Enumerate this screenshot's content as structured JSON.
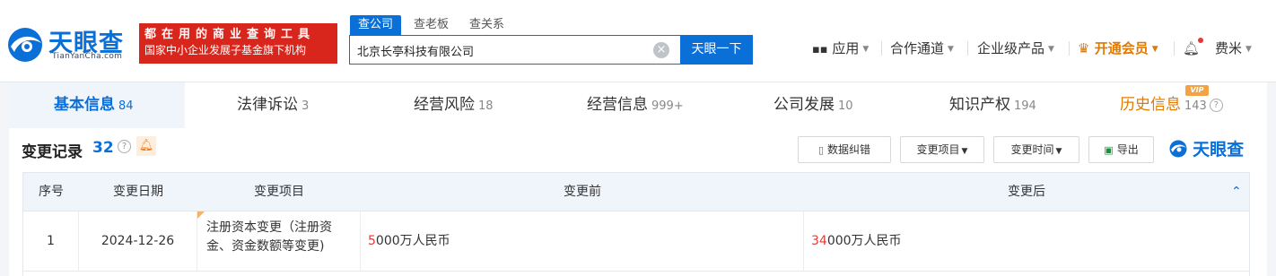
{
  "brand": {
    "name": "天眼查",
    "domain": "TianYanCha.com",
    "color": "#0b6fd8"
  },
  "slogan": {
    "line1": "都在用的商业查询工具",
    "line2": "国家中小企业发展子基金旗下机构"
  },
  "search_tabs": [
    "查公司",
    "查老板",
    "查关系"
  ],
  "search": {
    "value": "北京长亭科技有限公司",
    "button": "天眼一下"
  },
  "nav": {
    "apps": "应用",
    "channel": "合作通道",
    "enterprise": "企业级产品",
    "vip": "开通会员",
    "user": "费米"
  },
  "tabs": [
    {
      "label": "基本信息",
      "count": "84"
    },
    {
      "label": "法律诉讼",
      "count": "3"
    },
    {
      "label": "经营风险",
      "count": "18"
    },
    {
      "label": "经营信息",
      "count": "999+"
    },
    {
      "label": "公司发展",
      "count": "10"
    },
    {
      "label": "知识产权",
      "count": "194"
    },
    {
      "label": "历史信息",
      "count": "143"
    }
  ],
  "vip_badge": "VIP",
  "section": {
    "title": "变更记录",
    "count": "32",
    "buttons": {
      "correct": "数据纠错",
      "item": "变更项目",
      "time": "变更时间",
      "export": "导出"
    }
  },
  "table": {
    "columns": [
      "序号",
      "变更日期",
      "变更项目",
      "变更前",
      "变更后"
    ],
    "rows": [
      {
        "index": "1",
        "date": "2024-12-26",
        "item": "注册资本变更（注册资金、资金数额等变更)",
        "before_hl": "5",
        "before_rest": "000万人民币",
        "after_hl": "34",
        "after_rest": "000万人民币"
      }
    ]
  }
}
